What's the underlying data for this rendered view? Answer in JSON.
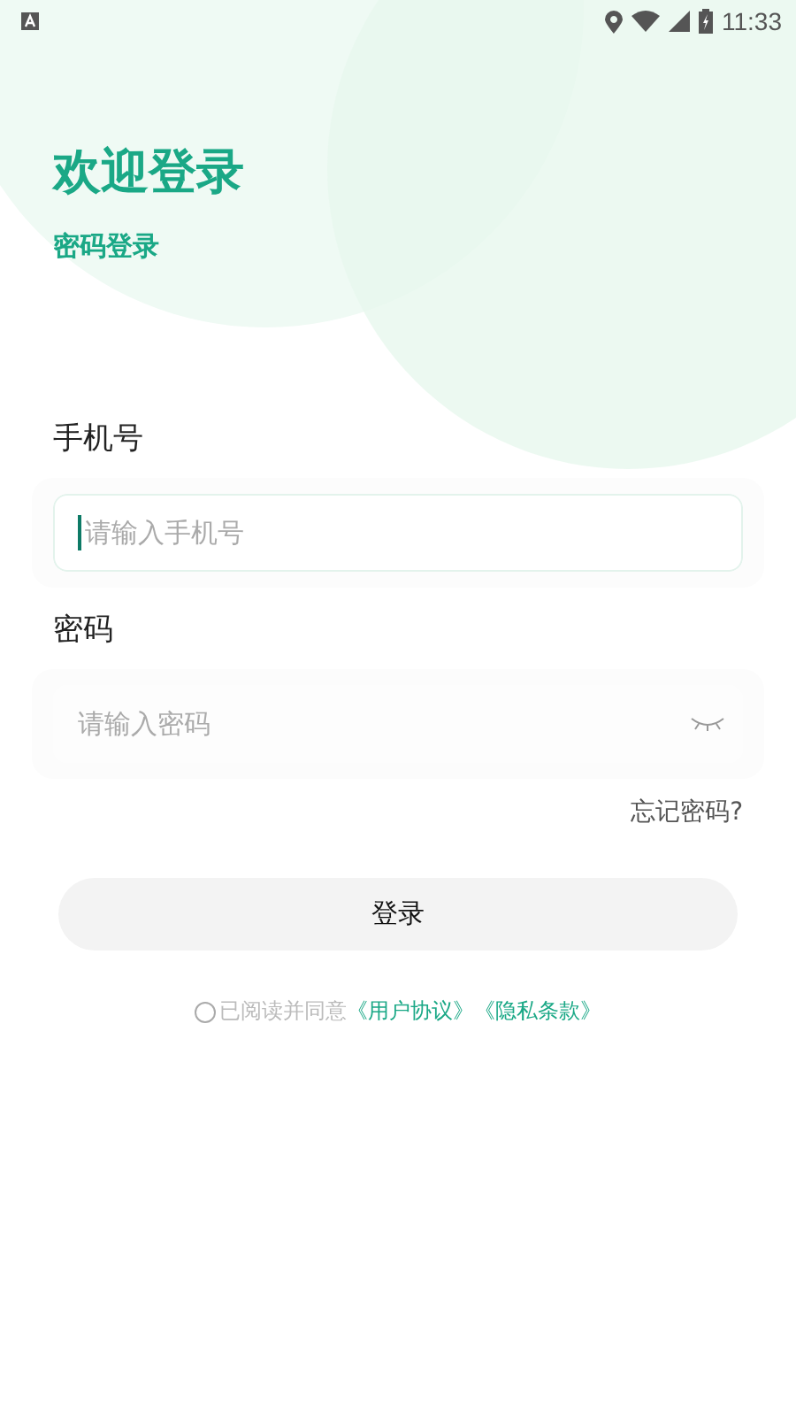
{
  "status_bar": {
    "time": "11:33"
  },
  "header": {
    "title": "欢迎登录",
    "subtitle": "密码登录"
  },
  "fields": [
    {
      "label": "手机号",
      "placeholder": "请输入手机号",
      "focused": true,
      "kind": "text"
    },
    {
      "label": "密码",
      "placeholder": "请输入密码",
      "focused": false,
      "kind": "password",
      "visible": false
    }
  ],
  "forgot_link": "忘记密码?",
  "login_button": "登录",
  "agreement": {
    "checked": false,
    "text": "已阅读并同意",
    "links": [
      "《用户协议》",
      "《隐私条款》"
    ]
  }
}
